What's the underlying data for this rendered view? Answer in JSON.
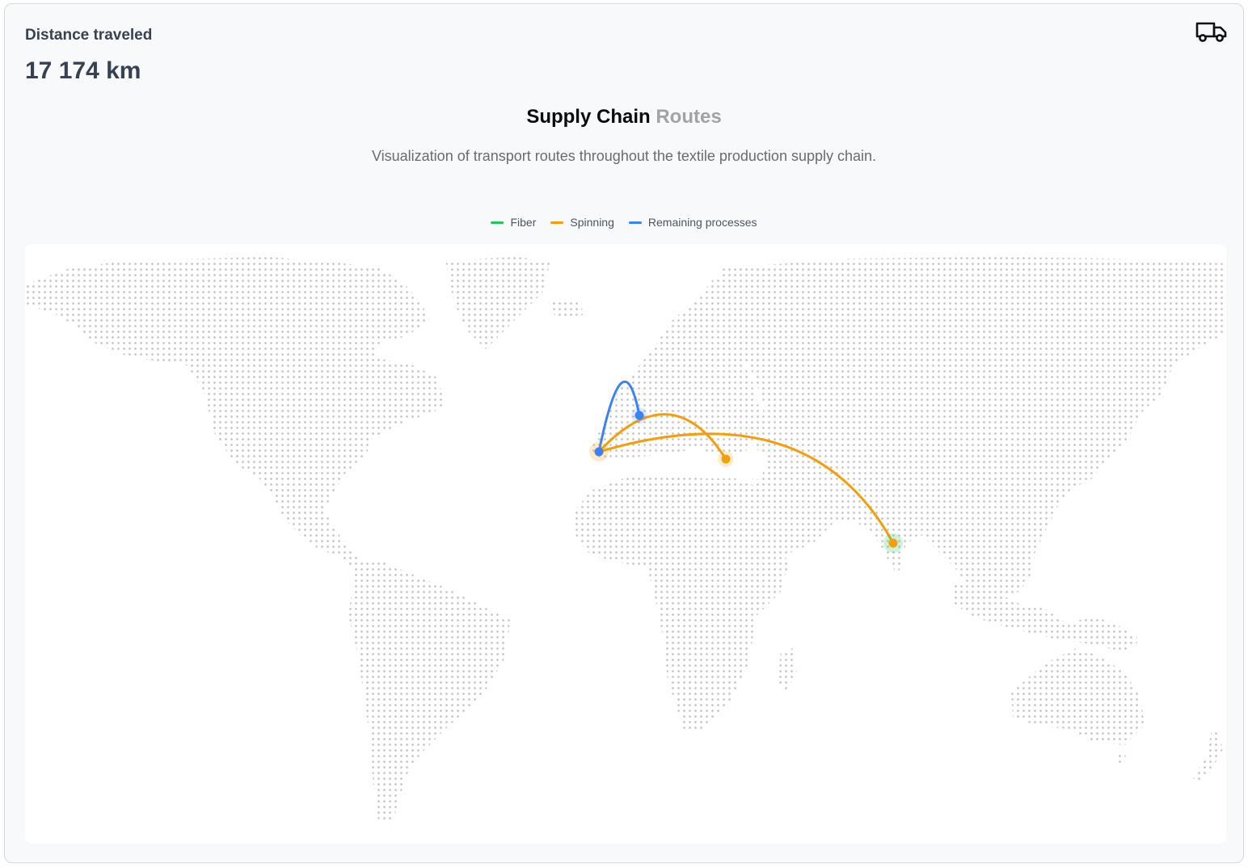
{
  "metric": {
    "label": "Distance traveled",
    "value": "17 174 km"
  },
  "icons": {
    "header_icon": "truck-icon"
  },
  "map": {
    "title_main": "Supply Chain",
    "title_accent": "Routes",
    "subtitle": "Visualization of transport routes throughout the textile production supply chain.",
    "legend": [
      {
        "label": "Fiber",
        "color": "#22c55e"
      },
      {
        "label": "Spinning",
        "color": "#f59e0b"
      },
      {
        "label": "Remaining processes",
        "color": "#3b82f6"
      }
    ],
    "land_dot_color": "#c4c4c4",
    "routes": [
      {
        "stage": "Spinning",
        "from": "India",
        "to": "Iberian Peninsula",
        "color": "#f59e0b"
      },
      {
        "stage": "Spinning",
        "from": "Turkey",
        "to": "Iberian Peninsula",
        "color": "#f59e0b"
      },
      {
        "stage": "Remaining processes",
        "from": "Central Europe",
        "to": "Iberian Peninsula",
        "color": "#3b82f6"
      }
    ]
  }
}
